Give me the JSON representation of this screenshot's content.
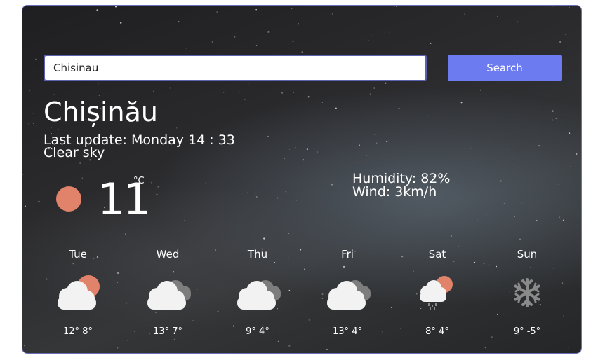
{
  "search": {
    "value": "Chisinau",
    "button_label": "Search"
  },
  "current": {
    "city": "Chișinău",
    "last_update": "Last update: Monday 14 : 33",
    "description": "Clear sky",
    "icon": "sun-icon",
    "temperature": "11",
    "unit": "°C",
    "humidity": "Humidity: 82%",
    "wind": "Wind: 3km/h"
  },
  "forecast": [
    {
      "day": "Tue",
      "icon": "cloud-sun-icon",
      "temps": "12° 8°"
    },
    {
      "day": "Wed",
      "icon": "cloudy-icon",
      "temps": "13° 7°"
    },
    {
      "day": "Thu",
      "icon": "cloudy-icon",
      "temps": "9° 4°"
    },
    {
      "day": "Fri",
      "icon": "cloudy-icon",
      "temps": "13° 4°"
    },
    {
      "day": "Sat",
      "icon": "sun-rain-icon",
      "temps": "8° 4°"
    },
    {
      "day": "Sun",
      "icon": "snowflake-icon",
      "temps": "9° -5°"
    }
  ],
  "colors": {
    "accent": "#6c7cf0",
    "sun": "#e0836a",
    "cloud": "#f2f2f2",
    "dark_cloud": "#7d7d7d"
  }
}
